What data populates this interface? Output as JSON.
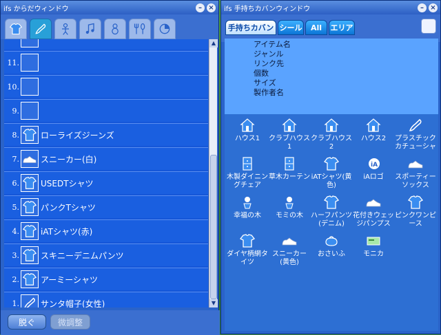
{
  "left_window": {
    "title": "ifs からだウィンドウ",
    "category_tabs": [
      {
        "icon": "shirt-icon",
        "active": false
      },
      {
        "icon": "brush-icon",
        "active": true
      },
      {
        "icon": "figure-icon",
        "active": false
      },
      {
        "icon": "music-note-icon",
        "active": false
      },
      {
        "icon": "person-icon",
        "active": false
      },
      {
        "icon": "food-icon",
        "active": false
      },
      {
        "icon": "pie-icon",
        "active": false
      }
    ],
    "rows": [
      {
        "num": "",
        "name": "",
        "icon": ""
      },
      {
        "num": "11.",
        "name": "",
        "icon": ""
      },
      {
        "num": "10.",
        "name": "",
        "icon": ""
      },
      {
        "num": "9.",
        "name": "",
        "icon": ""
      },
      {
        "num": "8.",
        "name": "ローライズジーンズ",
        "icon": "shirt-icon"
      },
      {
        "num": "7.",
        "name": "スニーカー(白)",
        "icon": "sneaker-icon"
      },
      {
        "num": "6.",
        "name": "USEDTシャツ",
        "icon": "shirt-icon"
      },
      {
        "num": "5.",
        "name": "パンクTシャツ",
        "icon": "shirt-icon"
      },
      {
        "num": "4.",
        "name": "iATシャツ(赤)",
        "icon": "shirt-icon"
      },
      {
        "num": "3.",
        "name": "スキニーデニムパンツ",
        "icon": "shirt-icon"
      },
      {
        "num": "2.",
        "name": "アーミーシャツ",
        "icon": "shirt-icon"
      },
      {
        "num": "1.",
        "name": "サンタ帽子(女性)",
        "icon": "brush-icon"
      }
    ],
    "buttons": {
      "undress": "脱ぐ",
      "adjust": "微調整"
    }
  },
  "right_window": {
    "title": "ifs 手持ちカバンウィンドウ",
    "tabs": [
      "手持ちカバン",
      "シール",
      "All",
      "エリア"
    ],
    "info_labels": [
      "アイテム名",
      "ジャンル",
      "リンク先",
      "個数",
      "サイズ",
      "製作者名"
    ],
    "items": [
      {
        "name": "ハウス1",
        "icon": "house-icon"
      },
      {
        "name": "クラブハウス1",
        "icon": "house-icon"
      },
      {
        "name": "クラブハウス2",
        "icon": "house-icon"
      },
      {
        "name": "ハウス2",
        "icon": "house-icon"
      },
      {
        "name": "プラスチックカチューシャ",
        "icon": "brush-icon"
      },
      {
        "name": "木製ダイニングチェア",
        "icon": "cabinet-icon"
      },
      {
        "name": "草木カーテン",
        "icon": "cabinet-icon"
      },
      {
        "name": "iATシャツ(黄色)",
        "icon": "shirt-icon"
      },
      {
        "name": "iAロゴ",
        "icon": "logo-icon"
      },
      {
        "name": "スポーティーソックス",
        "icon": "sneaker-icon"
      },
      {
        "name": "幸福の木",
        "icon": "plant-icon"
      },
      {
        "name": "モミの木",
        "icon": "plant-icon"
      },
      {
        "name": "ハーフパンツ(デニム)",
        "icon": "shirt-icon"
      },
      {
        "name": "花付きウェッジパンプス",
        "icon": "sneaker-icon"
      },
      {
        "name": "ピンクワンピース",
        "icon": "shirt-icon"
      },
      {
        "name": "ダイヤ柄網タイツ",
        "icon": "shirt-icon"
      },
      {
        "name": "スニーカー(黄色)",
        "icon": "sneaker-icon"
      },
      {
        "name": "おさいふ",
        "icon": "wallet-icon"
      },
      {
        "name": "モニカ",
        "icon": "card-icon"
      }
    ]
  }
}
